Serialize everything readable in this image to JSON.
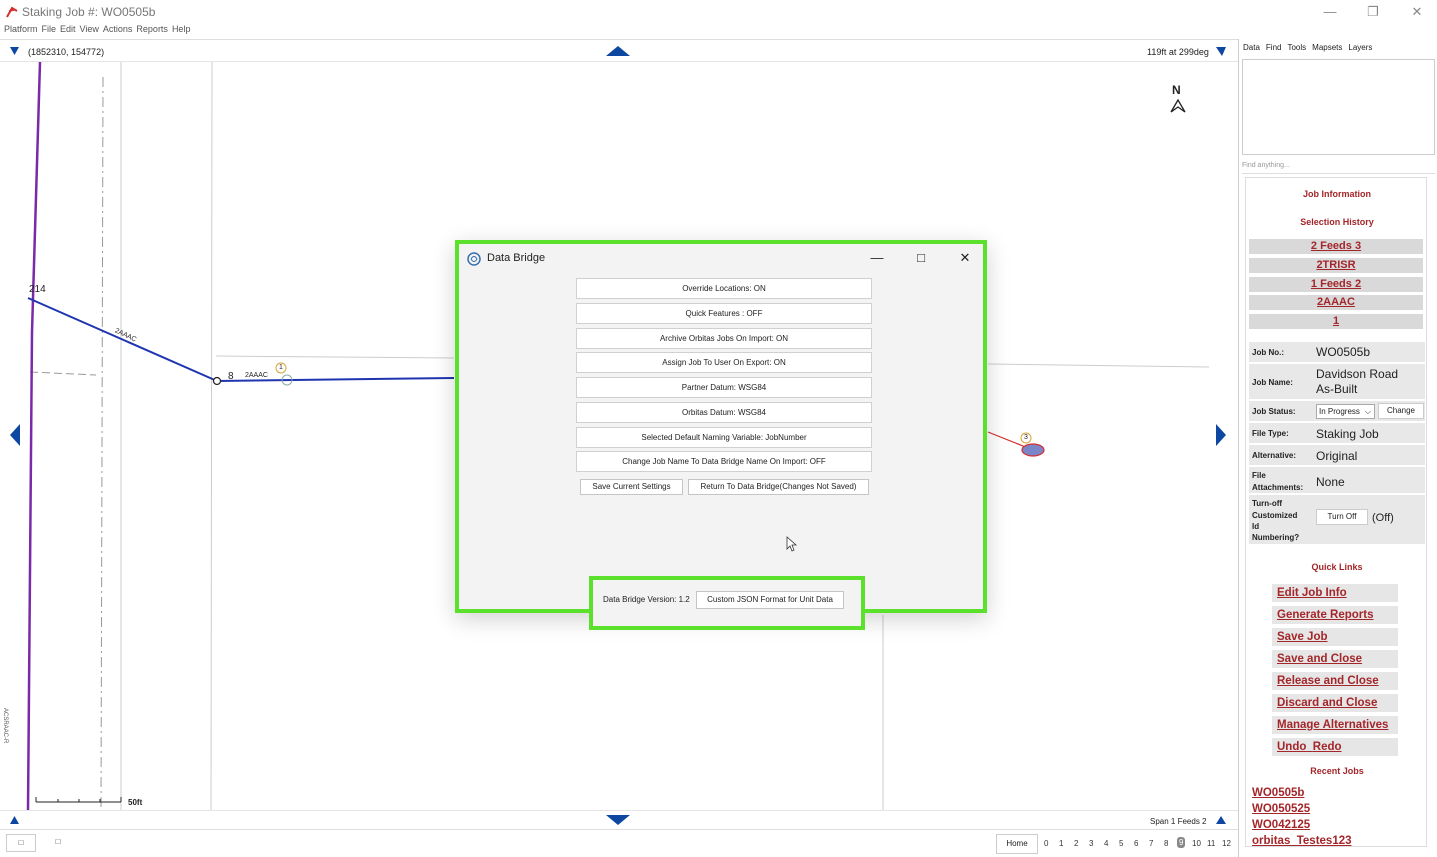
{
  "window": {
    "title": "Staking Job #: WO0505b",
    "minimize": "—",
    "maximize": "❐",
    "close": "✕"
  },
  "menu": [
    "Platform",
    "File",
    "Edit",
    "View",
    "Actions",
    "Reports",
    "Help"
  ],
  "map": {
    "coords": "(1852310, 154772)",
    "scale_info": "119ft at 299deg",
    "north": "N",
    "span_label": "Span 1 Feeds 2",
    "scale_bar": "50ft",
    "labels": {
      "node_214": "214",
      "line_2aaac_a": "2AAAC",
      "node_8": "8",
      "line_2aaac_b": "2AAAC",
      "pole_1": "1",
      "pole_3": "3",
      "vertical_label": "ACSRAAC-R"
    }
  },
  "statusbar": {
    "home": "Home",
    "zoom_levels": [
      "0",
      "1",
      "2",
      "3",
      "4",
      "5",
      "6",
      "7",
      "8",
      "9",
      "10",
      "11",
      "12"
    ],
    "zoom_selected": "9"
  },
  "dialog": {
    "title": "Data Bridge",
    "options": [
      "Override Locations: ON",
      "Quick Features : OFF",
      "Archive Orbitas Jobs On Import: ON",
      "Assign Job To User On Export: ON",
      "Partner Datum: WSG84",
      "Orbitas Datum: WSG84",
      "Selected Default Naming Variable: JobNumber",
      "Change Job Name To Data Bridge Name On Import: OFF"
    ],
    "save_button": "Save Current Settings",
    "return_button": "Return To Data Bridge(Changes Not Saved)",
    "version_label": "Data Bridge Version: 1.2",
    "json_button": "Custom JSON Format for Unit Data"
  },
  "panel": {
    "tabs": [
      "Data",
      "Find",
      "Tools",
      "Mapsets",
      "Layers"
    ],
    "search_placeholder": "Find anything...",
    "job_info_heading": "Job Information",
    "selection_history_heading": "Selection History",
    "selection_history": [
      "2 Feeds 3",
      "2TRISR",
      "1 Feeds 2",
      "2AAAC",
      "1"
    ],
    "job_no_label": "Job No.:",
    "job_no": "WO0505b",
    "job_name_label": "Job Name:",
    "job_name_line1": "Davidson Road",
    "job_name_line2": "As-Built",
    "job_status_label": "Job Status:",
    "job_status": "In Progress",
    "change_button": "Change",
    "file_type_label": "File Type:",
    "file_type": "Staking Job",
    "alternative_label": "Alternative:",
    "alternative": "Original",
    "file_attach_label1": "File",
    "file_attach_label2": "Attachments:",
    "file_attach": "None",
    "turnoff_label": [
      "Turn-off",
      "Customized",
      "Id",
      "Numbering?"
    ],
    "turnoff_button": "Turn Off",
    "turnoff_state": "(Off)",
    "quick_links_heading": "Quick Links",
    "quick_links": [
      "Edit Job Info",
      "Generate Reports",
      "Save Job",
      "Save and Close",
      "Release and Close",
      "Discard and Close",
      "Manage Alternatives"
    ],
    "undo": "Undo",
    "redo": "Redo",
    "recent_jobs_heading": "Recent Jobs",
    "recent_jobs": [
      "WO0505b",
      "WO050525",
      "WO042125",
      "orbitas_Testes123"
    ]
  },
  "colors": {
    "accent_green": "#5be02c",
    "link_red": "#a3262a",
    "line_blue": "#1f35b0",
    "line_purple": "#7a2aa8",
    "nav_blue": "#0d47a1"
  }
}
